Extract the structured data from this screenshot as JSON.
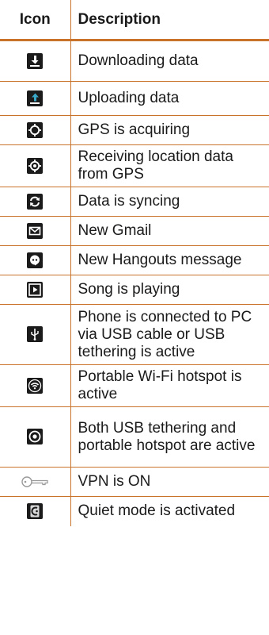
{
  "table": {
    "header_icon": "Icon",
    "header_description": "Description"
  },
  "rows": [
    {
      "icon": "download-icon",
      "description": "Downloading data"
    },
    {
      "icon": "upload-icon",
      "description": "Uploading data"
    },
    {
      "icon": "gps-acquiring-icon",
      "description": "GPS is acquiring"
    },
    {
      "icon": "gps-receiving-icon",
      "description": "Receiving location data from GPS"
    },
    {
      "icon": "sync-icon",
      "description": "Data is syncing"
    },
    {
      "icon": "gmail-icon",
      "description": "New Gmail"
    },
    {
      "icon": "hangouts-icon",
      "description": "New Hangouts message"
    },
    {
      "icon": "play-icon",
      "description": "Song is playing"
    },
    {
      "icon": "usb-icon",
      "description": "Phone is connected to PC via USB cable or USB tethering is active"
    },
    {
      "icon": "wifi-hotspot-icon",
      "description": "Portable Wi-Fi hotspot is active"
    },
    {
      "icon": "usb-and-hotspot-icon",
      "description": "Both USB tethering and portable hotspot are active"
    },
    {
      "icon": "vpn-key-icon",
      "description": "VPN is ON"
    },
    {
      "icon": "quiet-mode-icon",
      "description": "Quiet mode is activated"
    }
  ]
}
